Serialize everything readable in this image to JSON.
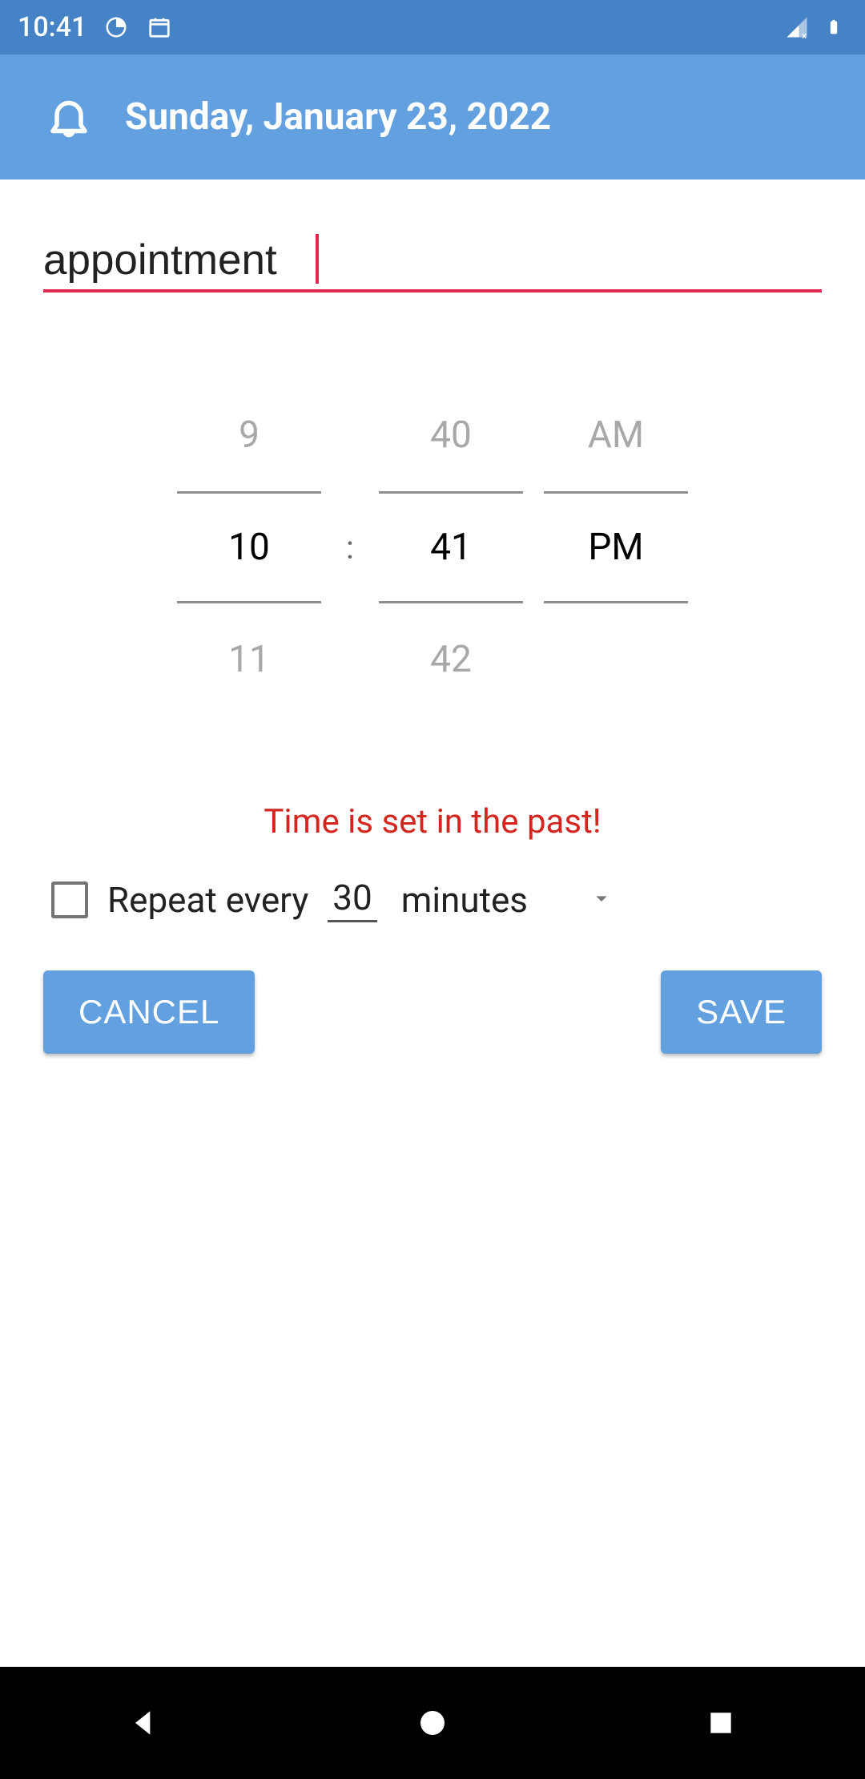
{
  "status": {
    "time": "10:41"
  },
  "header": {
    "date_title": "Sunday, January 23, 2022"
  },
  "form": {
    "title_value": "appointment"
  },
  "time_picker": {
    "hour_prev": "9",
    "hour": "10",
    "hour_next": "11",
    "minute_prev": "40",
    "minute": "41",
    "minute_next": "42",
    "ampm_prev": "AM",
    "ampm": "PM",
    "ampm_next": "",
    "colon": ":"
  },
  "warning_text": "Time is set in the past!",
  "repeat": {
    "label": "Repeat every",
    "value": "30",
    "unit": "minutes"
  },
  "buttons": {
    "cancel": "CANCEL",
    "save": "SAVE"
  }
}
